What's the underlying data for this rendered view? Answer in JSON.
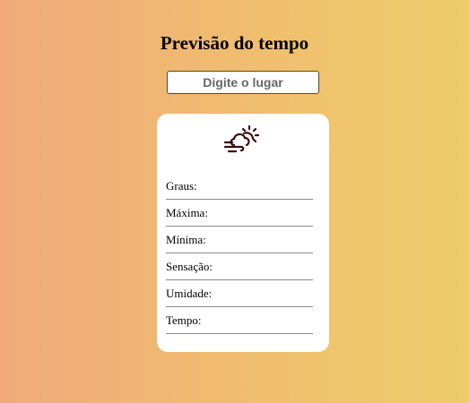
{
  "header": {
    "title": "Previsão do tempo"
  },
  "search": {
    "placeholder": "Digite o lugar",
    "value": ""
  },
  "weather_card": {
    "icon": "cloud-sun-wind-icon",
    "fields": [
      {
        "label": "Graus:",
        "value": ""
      },
      {
        "label": "Máxima:",
        "value": ""
      },
      {
        "label": "Mínima:",
        "value": ""
      },
      {
        "label": "Sensação:",
        "value": ""
      },
      {
        "label": "Umidade:",
        "value": ""
      },
      {
        "label": "Tempo:",
        "value": ""
      }
    ]
  },
  "colors": {
    "gradient_start": "#f0aa7a",
    "gradient_end": "#eecc6a",
    "icon_color": "#3a0a0a"
  }
}
